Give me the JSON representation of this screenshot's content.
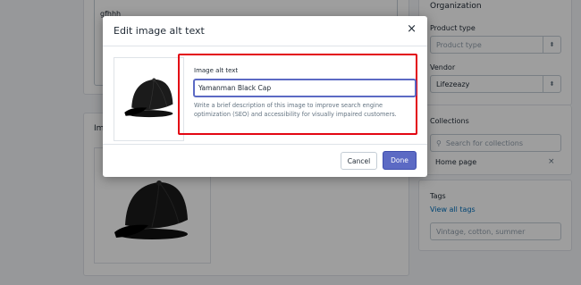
{
  "background": {
    "description_text": "gfhhh",
    "images_heading": "Im",
    "organization": {
      "heading": "Organization",
      "product_type_label": "Product type",
      "product_type_placeholder": "Product type",
      "vendor_label": "Vendor",
      "vendor_value": "Lifezeazy",
      "collections_label": "Collections",
      "collections_search_placeholder": "Search for collections",
      "collection_item": "Home page",
      "collection_remove": "×",
      "tags_label": "Tags",
      "tags_link": "View all tags",
      "tags_placeholder": "Vintage, cotton, summer"
    }
  },
  "modal": {
    "title": "Edit image alt text",
    "close_glyph": "×",
    "alt_label": "Image alt text",
    "alt_value": "Yamanman Black Cap",
    "help_text": "Write a brief description of this image to improve search engine optimization (SEO) and accessibility for visually impaired customers.",
    "cancel_label": "Cancel",
    "done_label": "Done"
  },
  "colors": {
    "accent": "#5c6ac4",
    "highlight_box": "#e30613"
  }
}
